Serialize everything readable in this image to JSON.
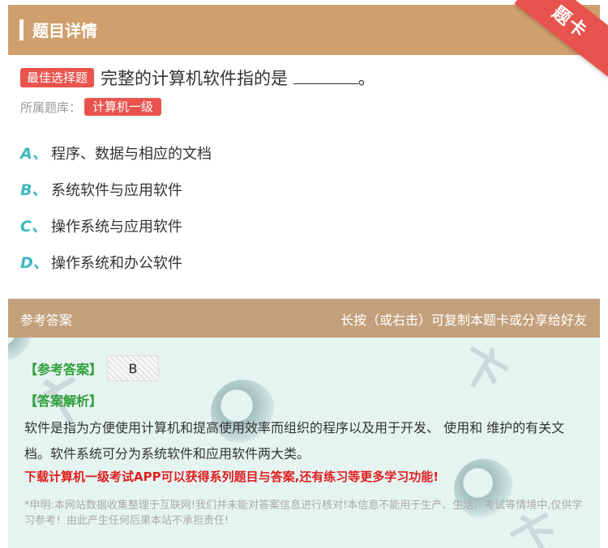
{
  "header": {
    "title": "题目详情",
    "ribbon": "题卡"
  },
  "question": {
    "type_badge": "最佳选择题",
    "text": "完整的计算机软件指的是 ",
    "text_end": "。",
    "bank_label": "所属题库：",
    "bank_name": "计算机一级"
  },
  "options": [
    {
      "letter": "A、",
      "text": "程序、数据与相应的文档"
    },
    {
      "letter": "B、",
      "text": "系统软件与应用软件"
    },
    {
      "letter": "C、",
      "text": "操作系统与应用软件"
    },
    {
      "letter": "D、",
      "text": "操作系统和办公软件"
    }
  ],
  "answer_section": {
    "left": "参考答案",
    "right": "长按（或右击）可复制本题卡或分享给好友",
    "ref_label": "【参考答案】",
    "ref_value": "B",
    "analysis_label": "【答案解析】",
    "analysis": "软件是指为方便使用计算机和提高使用效率而组织的程序以及用于开发、 使用和 维护的有关文档。软件系统可分为系统软件和应用软件两大类。",
    "promo": "下载计算机一级考试APP可以获得系列题目与答案,还有练习等更多学习功能!",
    "disclaimer": "*申明:本网站数据收集整理于互联网!我们并未能对答案信息进行核对!本信息不能用于生产、生活、考试等情境中,仅供学习参考！由此产生任何后果本站不承担责任!"
  },
  "colors": {
    "header_bg": "#cf9f6d",
    "ribbon": "#e8534e",
    "badge": "#e8534e",
    "option_letter": "#3cb8bd",
    "answer_head_bg": "#c3a07c",
    "answer_body_bg": "#e6f4f1",
    "green_label": "#2fa03a",
    "promo": "#e01f1f"
  }
}
